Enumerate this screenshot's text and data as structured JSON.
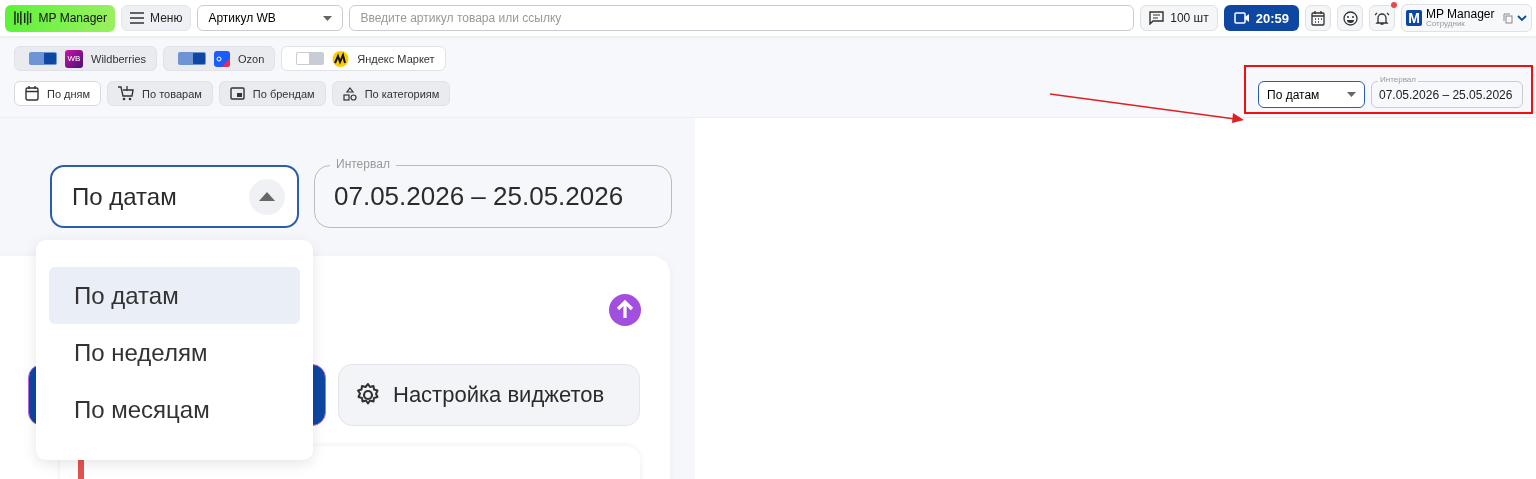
{
  "header": {
    "logo": "MP Manager",
    "menu": "Меню",
    "search_type": "Артикул WB",
    "search": {
      "placeholder": "Введите артикул товара или ссылку"
    },
    "quota": "100 шт",
    "timer": "20:59",
    "notifications_unread": true,
    "user": {
      "initial": "M",
      "name": "MP Manager",
      "role": "Сотрудник"
    }
  },
  "marketplaces": [
    {
      "kind": "wb",
      "name": "Wildberries",
      "badge": "WB",
      "on": true
    },
    {
      "kind": "ozon",
      "name": "Ozon",
      "on": true
    },
    {
      "kind": "yandex",
      "name": "Яндекс Маркет",
      "on": false
    }
  ],
  "views": [
    {
      "kind": "calendar",
      "label": "По дням",
      "selected": true
    },
    {
      "kind": "cart",
      "label": "По товарам",
      "selected": false
    },
    {
      "kind": "brand",
      "label": "По брендам",
      "selected": false
    },
    {
      "kind": "shapes",
      "label": "По категориям",
      "selected": false
    }
  ],
  "period": {
    "mode": "По датам",
    "interval_label": "Интервал",
    "interval": "07.05.2026 – 25.05.2026"
  },
  "zoom": {
    "mode": "По датам",
    "expanded": true,
    "interval_label": "Интервал",
    "interval": "07.05.2026 – 25.05.2026",
    "options": [
      {
        "label": "По датам",
        "selected": true
      },
      {
        "label": "По неделям",
        "selected": false
      },
      {
        "label": "По месяцам",
        "selected": false
      }
    ],
    "settings_button": "Настройка виджетов"
  }
}
